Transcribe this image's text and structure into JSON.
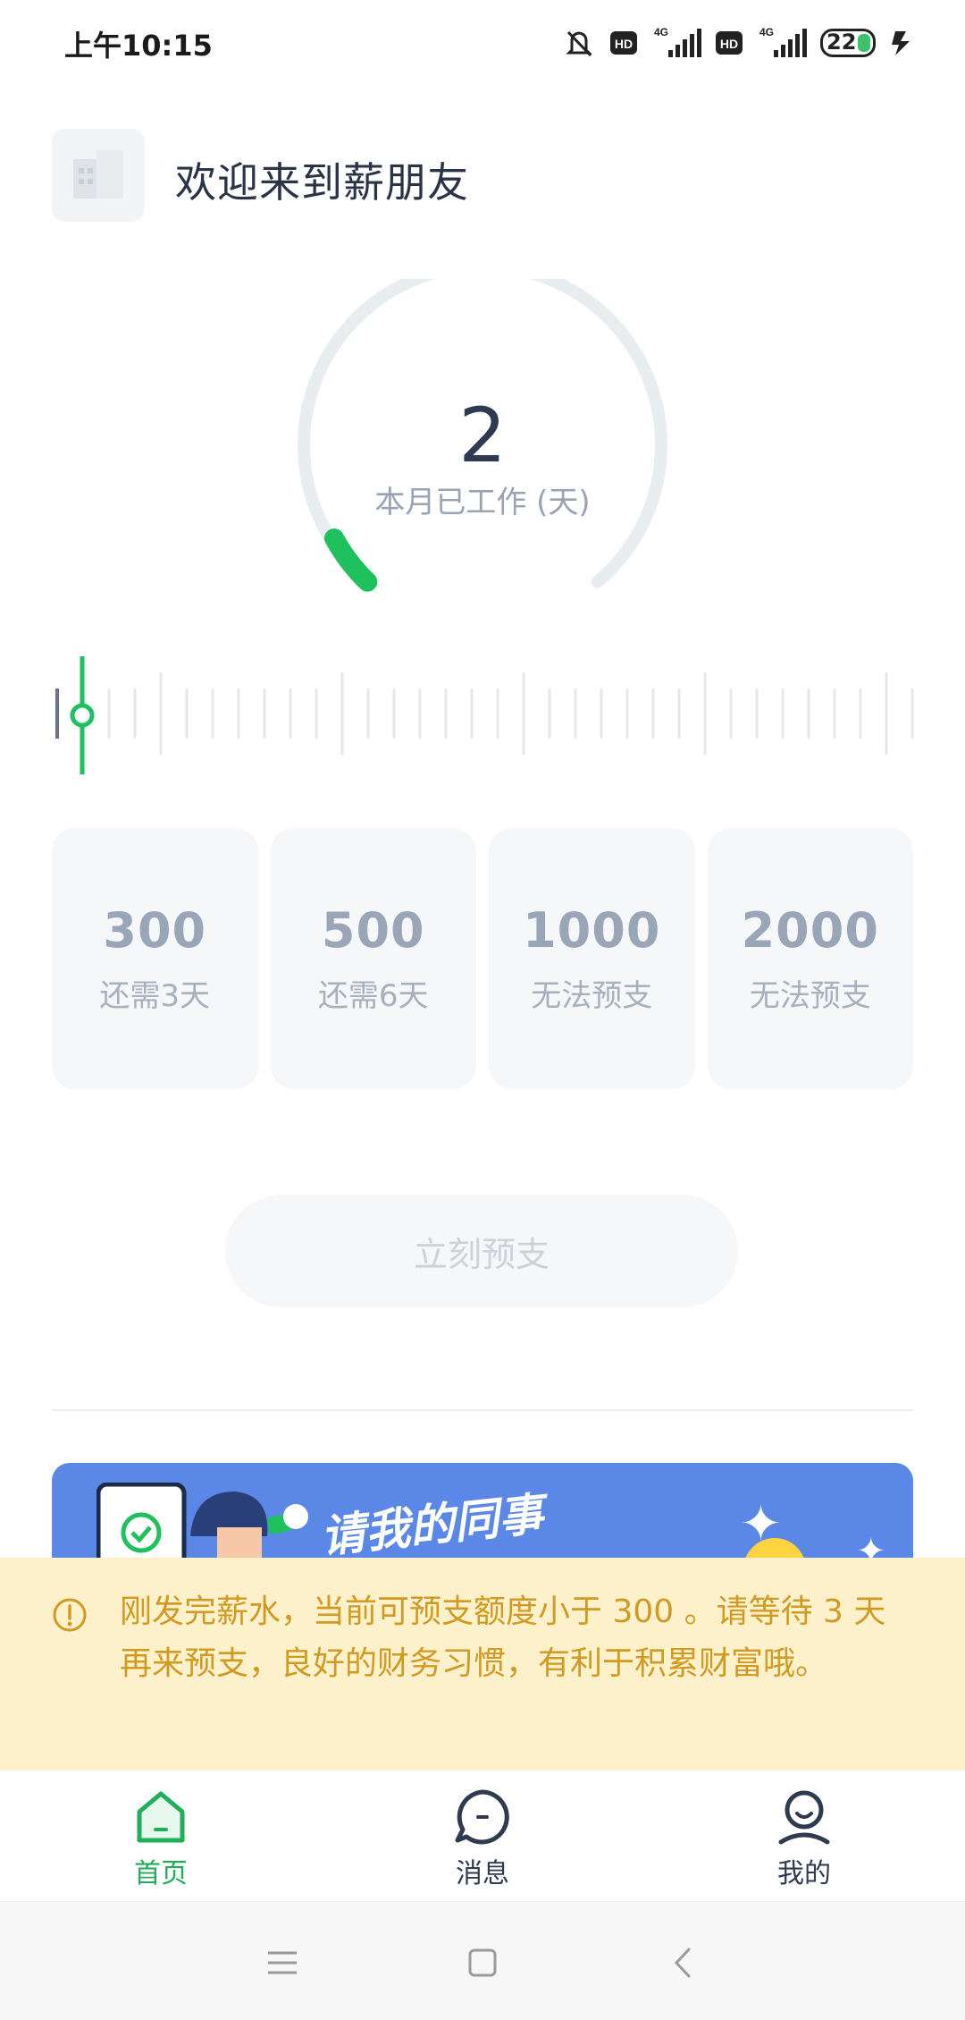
{
  "status_bar": {
    "time": "上午10:15",
    "battery": "22",
    "icons": [
      "mute-icon",
      "hd-icon",
      "signal-4g-icon",
      "hd-icon",
      "signal-4g-icon",
      "battery-icon",
      "charging-icon"
    ]
  },
  "header": {
    "welcome": "欢迎来到薪朋友",
    "logo_icon": "building-icon"
  },
  "gauge": {
    "value": "2",
    "label": "本月已工作 (天)",
    "progress_fraction": 0.07
  },
  "tiers": [
    {
      "amount": "300",
      "status": "还需3天"
    },
    {
      "amount": "500",
      "status": "还需6天"
    },
    {
      "amount": "1000",
      "status": "无法预支"
    },
    {
      "amount": "2000",
      "status": "无法预支"
    }
  ],
  "action": {
    "advance_label": "立刻预支"
  },
  "banner": {
    "text": "请我的同事"
  },
  "notice": {
    "text": "刚发完薪水，当前可预支额度小于 300 。请等待 3 天再来预支，良好的财务习惯，有利于积累财富哦。"
  },
  "tabbar": {
    "items": [
      {
        "label": "首页",
        "icon": "home-icon",
        "active": true
      },
      {
        "label": "消息",
        "icon": "message-icon",
        "active": false
      },
      {
        "label": "我的",
        "icon": "profile-icon",
        "active": false
      }
    ]
  },
  "colors": {
    "accent": "#1fae5a",
    "gauge_track": "#e8edf0",
    "notice_bg": "#fdf1cc",
    "notice_text": "#d19a22",
    "banner_bg": "#5b88e6"
  }
}
